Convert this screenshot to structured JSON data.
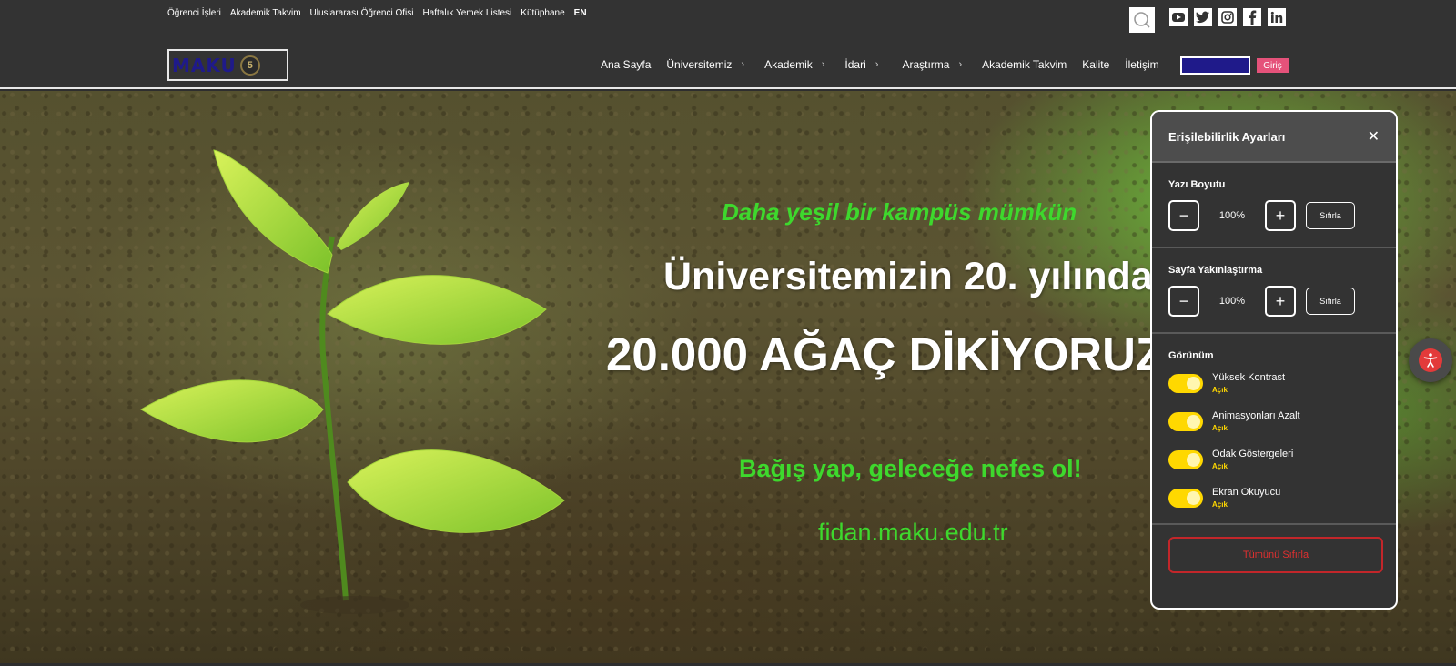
{
  "top_links": [
    "Öğrenci İşleri",
    "Akademik Takvim",
    "Uluslararası Öğrenci Ofisi",
    "Haftalık Yemek Listesi",
    "Kütüphane",
    "EN"
  ],
  "social_icons": [
    "youtube-icon",
    "twitter-icon",
    "instagram-icon",
    "facebook-icon",
    "linkedin-icon"
  ],
  "logo": {
    "text": "MAKU",
    "badge": "5"
  },
  "nav": {
    "items": [
      {
        "label": "Ana Sayfa",
        "has_submenu": false
      },
      {
        "label": "Üniversitemiz",
        "has_submenu": true
      },
      {
        "label": "Akademik",
        "has_submenu": true
      },
      {
        "label": "İdari",
        "has_submenu": true
      },
      {
        "label": "Araştırma",
        "has_submenu": true
      },
      {
        "label": "Akademik Takvim",
        "has_submenu": false
      },
      {
        "label": "Kalite",
        "has_submenu": false
      },
      {
        "label": "İletişim",
        "has_submenu": false
      }
    ],
    "login_label": "Giriş"
  },
  "hero": {
    "line1": "Daha yeşil bir kampüs mümkün",
    "line2": "Üniversitemizin 20. yılında",
    "line3": "20.000 AĞAÇ DİKİYORUZ",
    "line4": "Bağış yap, geleceğe nefes ol!",
    "line5": "fidan.maku.edu.tr"
  },
  "accessibility": {
    "title": "Erişilebilirlik Ayarları",
    "font_size": {
      "label": "Yazı Boyutu",
      "value": "100%",
      "reset": "Sıfırla"
    },
    "zoom": {
      "label": "Sayfa Yakınlaştırma",
      "value": "100%",
      "reset": "Sıfırla"
    },
    "appearance_label": "Görünüm",
    "toggles": [
      {
        "label": "Yüksek Kontrast",
        "state": "Açık"
      },
      {
        "label": "Animasyonları Azalt",
        "state": "Açık"
      },
      {
        "label": "Odak Göstergeleri",
        "state": "Açık"
      },
      {
        "label": "Ekran Okuyucu",
        "state": "Açık"
      }
    ],
    "reset_all": "Tümünü Sıfırla"
  },
  "colors": {
    "accent_green": "#3ed82d",
    "toggle_on": "#ffd800",
    "login_pink": "#e5527a",
    "danger_red": "#c3262a"
  }
}
